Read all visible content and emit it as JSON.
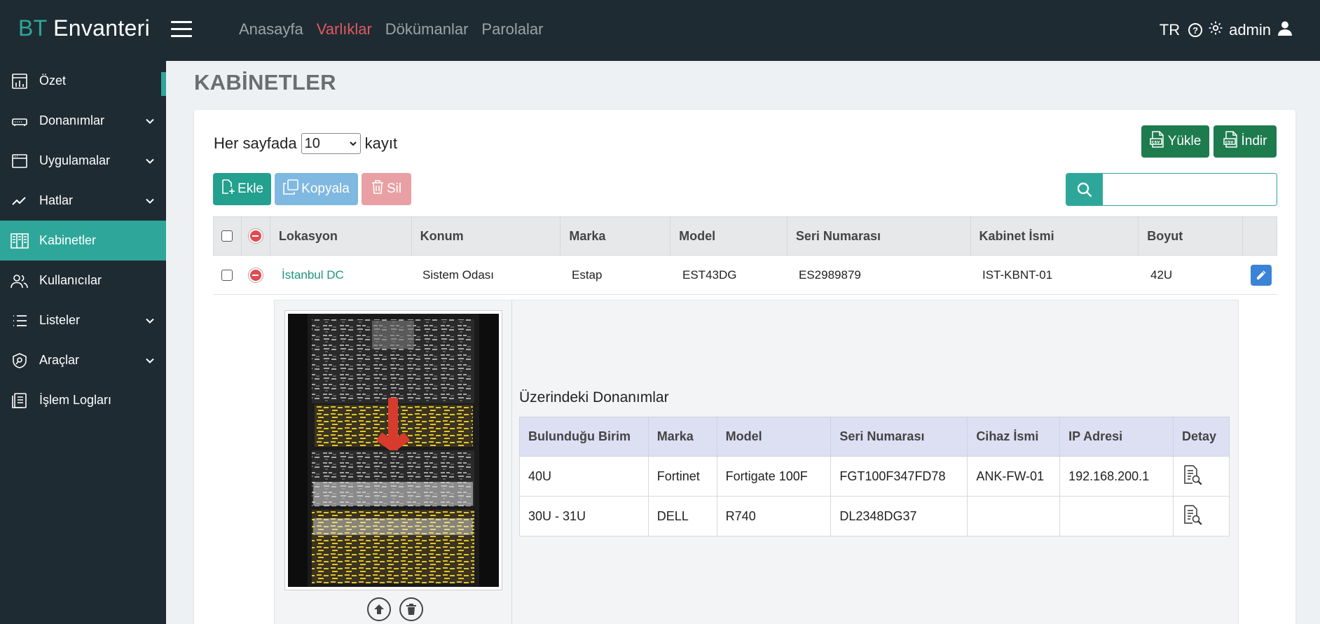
{
  "brand": {
    "prefix": "BT",
    "name": " Envanteri"
  },
  "topnav": [
    {
      "label": "Anasayfa",
      "active": false
    },
    {
      "label": "Varlıklar",
      "active": true
    },
    {
      "label": "Dökümanlar",
      "active": false
    },
    {
      "label": "Parolalar",
      "active": false
    }
  ],
  "topright": {
    "lang": "TR",
    "help": "?",
    "user": "admin"
  },
  "sidebar": {
    "items": [
      {
        "label": "Özet",
        "icon": "summary-icon",
        "chevron": false
      },
      {
        "label": "Donanımlar",
        "icon": "hardware-icon",
        "chevron": true
      },
      {
        "label": "Uygulamalar",
        "icon": "window-icon",
        "chevron": true
      },
      {
        "label": "Hatlar",
        "icon": "line-chart-icon",
        "chevron": true
      },
      {
        "label": "Kabinetler",
        "icon": "cabinet-icon",
        "chevron": false,
        "active": true
      },
      {
        "label": "Kullanıcılar",
        "icon": "users-icon",
        "chevron": false
      },
      {
        "label": "Listeler",
        "icon": "list-icon",
        "chevron": true
      },
      {
        "label": "Araçlar",
        "icon": "tools-icon",
        "chevron": true
      },
      {
        "label": "İşlem Logları",
        "icon": "log-icon",
        "chevron": false
      }
    ]
  },
  "page": {
    "title": "KABİNETLER"
  },
  "perpage": {
    "before": "Her sayfada",
    "value": "10",
    "after": "kayıt"
  },
  "buttons": {
    "upload": "Yükle",
    "download": "İndir",
    "add": "Ekle",
    "copy": "Kopyala",
    "delete": "Sil"
  },
  "search": {
    "placeholder": "",
    "value": ""
  },
  "table": {
    "headers": [
      "Lokasyon",
      "Konum",
      "Marka",
      "Model",
      "Seri Numarası",
      "Kabinet İsmi",
      "Boyut"
    ],
    "rows": [
      {
        "lokasyon": "İstanbul DC",
        "konum": "Sistem Odası",
        "marka": "Estap",
        "model": "EST43DG",
        "seri": "ES2989879",
        "isim": "IST-KBNT-01",
        "boyut": "42U"
      }
    ]
  },
  "detail": {
    "title": "Üzerindeki Donanımlar",
    "headers": [
      "Bulunduğu Birim",
      "Marka",
      "Model",
      "Seri Numarası",
      "Cihaz İsmi",
      "IP Adresi",
      "Detay"
    ],
    "rows": [
      {
        "birim": "40U",
        "marka": "Fortinet",
        "model": "Fortigate 100F",
        "seri": "FGT100F347FD78",
        "cihaz": "ANK-FW-01",
        "ip": "192.168.200.1"
      },
      {
        "birim": "30U - 31U",
        "marka": "DELL",
        "model": "R740",
        "seri": "DL2348DG37",
        "cihaz": "",
        "ip": ""
      }
    ]
  },
  "colors": {
    "accent": "#2ea79a",
    "sidebar_bg": "#1f2b33",
    "active_nav": "#e0595f",
    "csv_green": "#1e7b4e"
  }
}
